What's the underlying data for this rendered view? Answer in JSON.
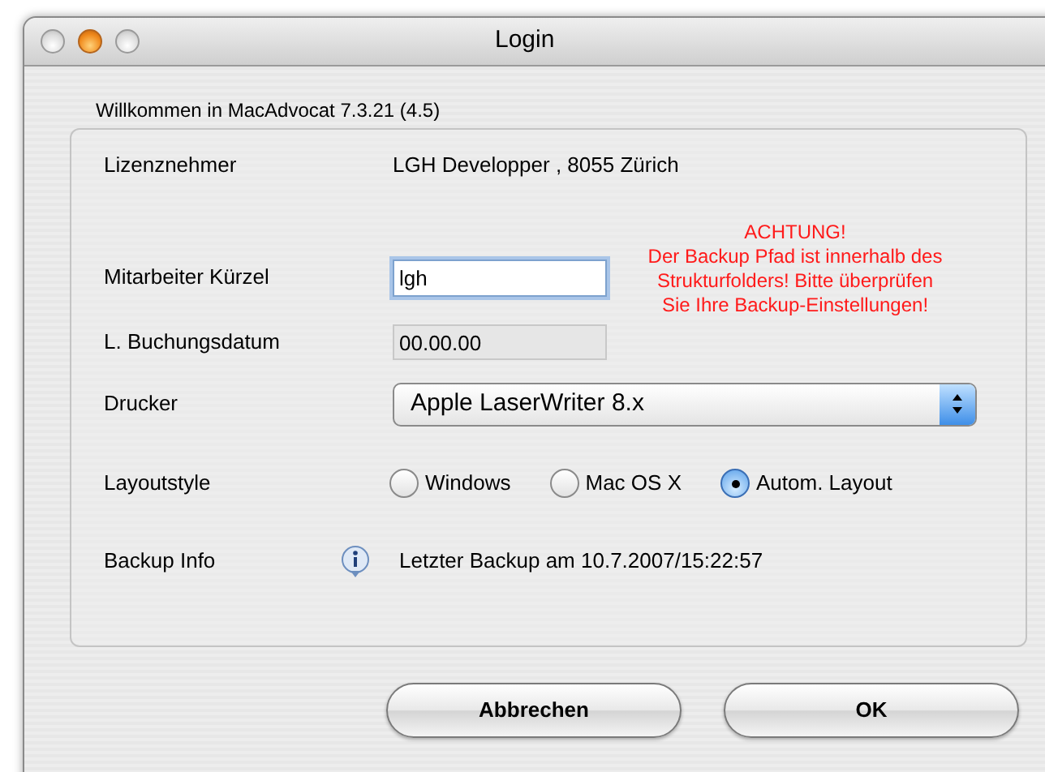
{
  "window": {
    "title": "Login",
    "traffic_lights": [
      {
        "lit": false
      },
      {
        "lit": true
      },
      {
        "lit": false
      }
    ]
  },
  "welcome": "Willkommen in MacAdvocat 7.3.21 (4.5)",
  "license": {
    "label": "Lizenznehmer",
    "value": "LGH Developper , 8055 Zürich"
  },
  "employee": {
    "label": "Mitarbeiter Kürzel",
    "value": "lgh",
    "focused": true
  },
  "booking_date": {
    "label": "L. Buchungsdatum",
    "value": "00.00.00",
    "disabled": true
  },
  "warning": {
    "title": "ACHTUNG!",
    "text": "Der Backup Pfad ist innerhalb des Strukturfolders! Bitte überprüfen Sie Ihre Backup-Einstellungen!"
  },
  "printer": {
    "label": "Drucker",
    "value": "Apple LaserWriter 8.x"
  },
  "layout_style": {
    "label": "Layoutstyle",
    "options": [
      {
        "label": "Windows",
        "selected": false
      },
      {
        "label": "Mac OS X",
        "selected": false
      },
      {
        "label": "Autom. Layout",
        "selected": true
      }
    ]
  },
  "backup_info": {
    "label": "Backup Info",
    "value": "Letzter Backup am 10.7.2007/15:22:57"
  },
  "buttons": [
    {
      "label": "Abbrechen"
    },
    {
      "label": "OK"
    }
  ]
}
